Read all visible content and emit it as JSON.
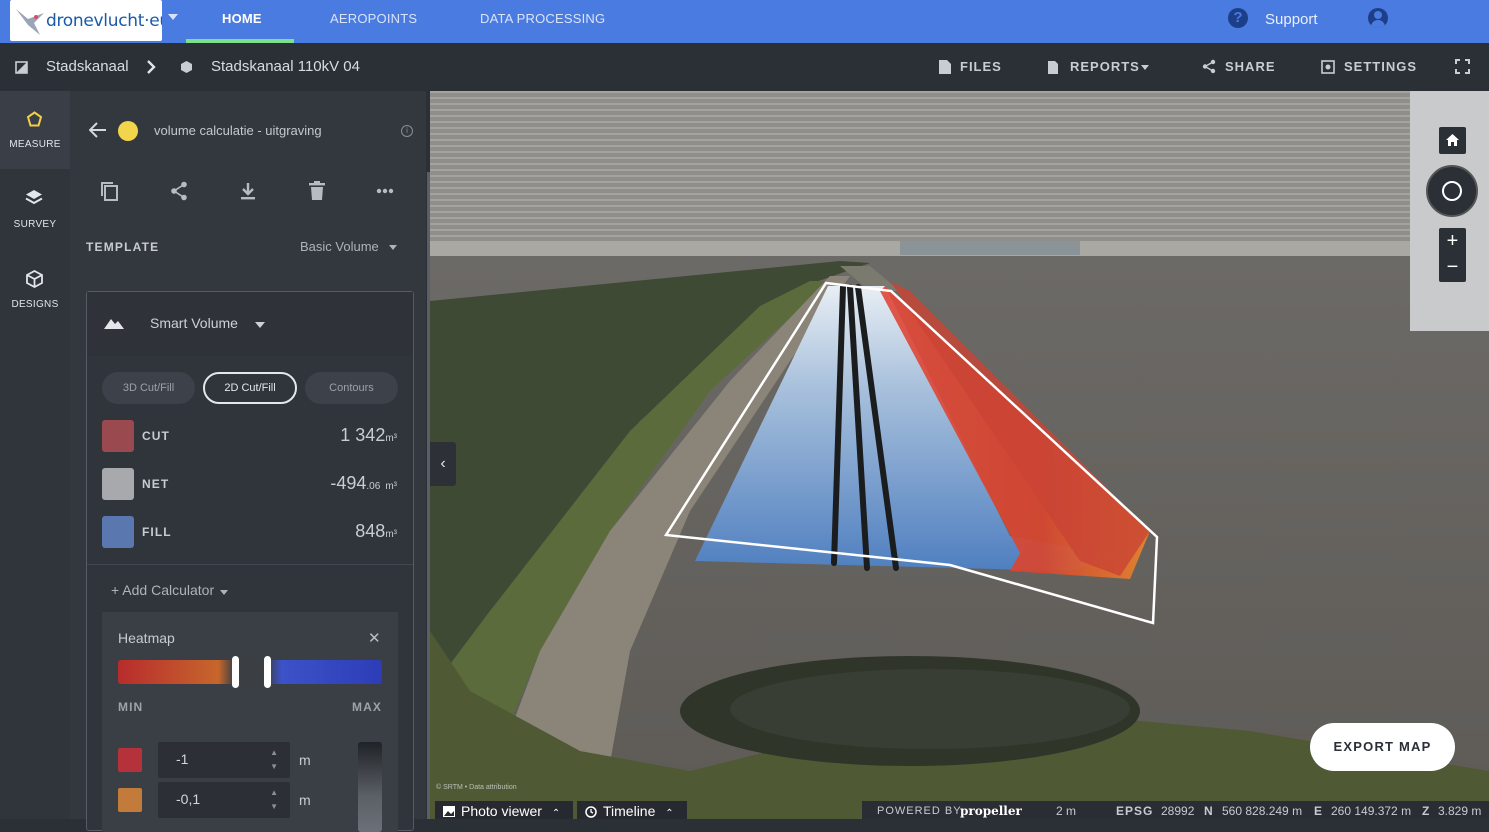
{
  "brand": {
    "logo_text": "dronevlucht·eu"
  },
  "nav": {
    "items": [
      {
        "label": "HOME",
        "active": true
      },
      {
        "label": "AEROPOINTS",
        "active": false
      },
      {
        "label": "DATA PROCESSING",
        "active": false
      }
    ],
    "support": "Support"
  },
  "breadcrumb": {
    "site": "Stadskanaal",
    "survey": "Stadskanaal 110kV 04"
  },
  "toolbar": {
    "files": "FILES",
    "reports": "REPORTS",
    "share": "SHARE",
    "settings": "SETTINGS"
  },
  "rail": {
    "measure": "MEASURE",
    "survey": "SURVEY",
    "designs": "DESIGNS"
  },
  "measurement": {
    "name": "volume calculatie - uitgraving",
    "dot_color": "#f3d54c",
    "template_label": "TEMPLATE",
    "template_value": "Basic Volume",
    "method": "Smart Volume",
    "modes": [
      "3D Cut/Fill",
      "2D Cut/Fill",
      "Contours"
    ],
    "active_mode": "2D Cut/Fill",
    "rows": [
      {
        "label": "CUT",
        "value": "1 342",
        "decimals": "",
        "unit": "m³",
        "color": "#9a4a4f"
      },
      {
        "label": "NET",
        "value": "-494",
        "decimals": ".06",
        "unit": "m³",
        "color": "#a7a9ad"
      },
      {
        "label": "FILL",
        "value": "848",
        "decimals": "",
        "unit": "m³",
        "color": "#5b77b0"
      }
    ],
    "add_calculator": "+ Add Calculator"
  },
  "heatmap": {
    "title": "Heatmap",
    "min_label": "MIN",
    "max_label": "MAX",
    "inputs": [
      {
        "value": "-1",
        "unit": "m",
        "color": "#b5323a"
      },
      {
        "value": "-0,1",
        "unit": "m",
        "color": "#c27b3a"
      }
    ]
  },
  "map": {
    "export_label": "EXPORT MAP",
    "attribution": "© SRTM • Data attribution",
    "photo_viewer": "Photo viewer",
    "timeline": "Timeline",
    "powered_by": "POWERED BY",
    "powered_brand": "propeller",
    "scale": "2 m",
    "epsg_label": "EPSG",
    "epsg": "28992",
    "n_label": "N",
    "n_value": "560 828.249 m",
    "e_label": "E",
    "e_value": "260 149.372 m",
    "z_label": "Z",
    "z_value": "3.829 m"
  }
}
